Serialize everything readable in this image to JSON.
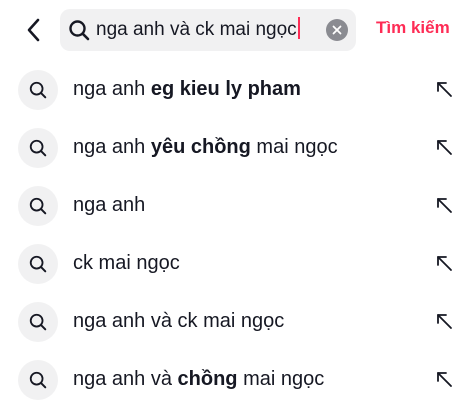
{
  "header": {
    "back_icon": "chevron-left-icon",
    "search_icon": "search-icon",
    "query": "nga anh và ck mai ngọc",
    "clear_icon": "clear-x-icon",
    "submit_label": "Tìm kiếm",
    "accent_color": "#fe2c55"
  },
  "suggestions": [
    {
      "normal": "nga anh ",
      "bold": "eg kieu ly pham",
      "tail": ""
    },
    {
      "normal": "nga anh ",
      "bold": "yêu chồng",
      "tail": " mai ngọc"
    },
    {
      "normal": "nga anh",
      "bold": "",
      "tail": ""
    },
    {
      "normal": "ck mai ngọc",
      "bold": "",
      "tail": ""
    },
    {
      "normal": "nga anh và ck mai ngọc",
      "bold": "",
      "tail": ""
    },
    {
      "normal": "nga anh và ",
      "bold": "chồng",
      "tail": " mai ngọc"
    }
  ],
  "row_icons": {
    "leading": "search-icon",
    "trailing": "fill-query-arrow-icon"
  }
}
